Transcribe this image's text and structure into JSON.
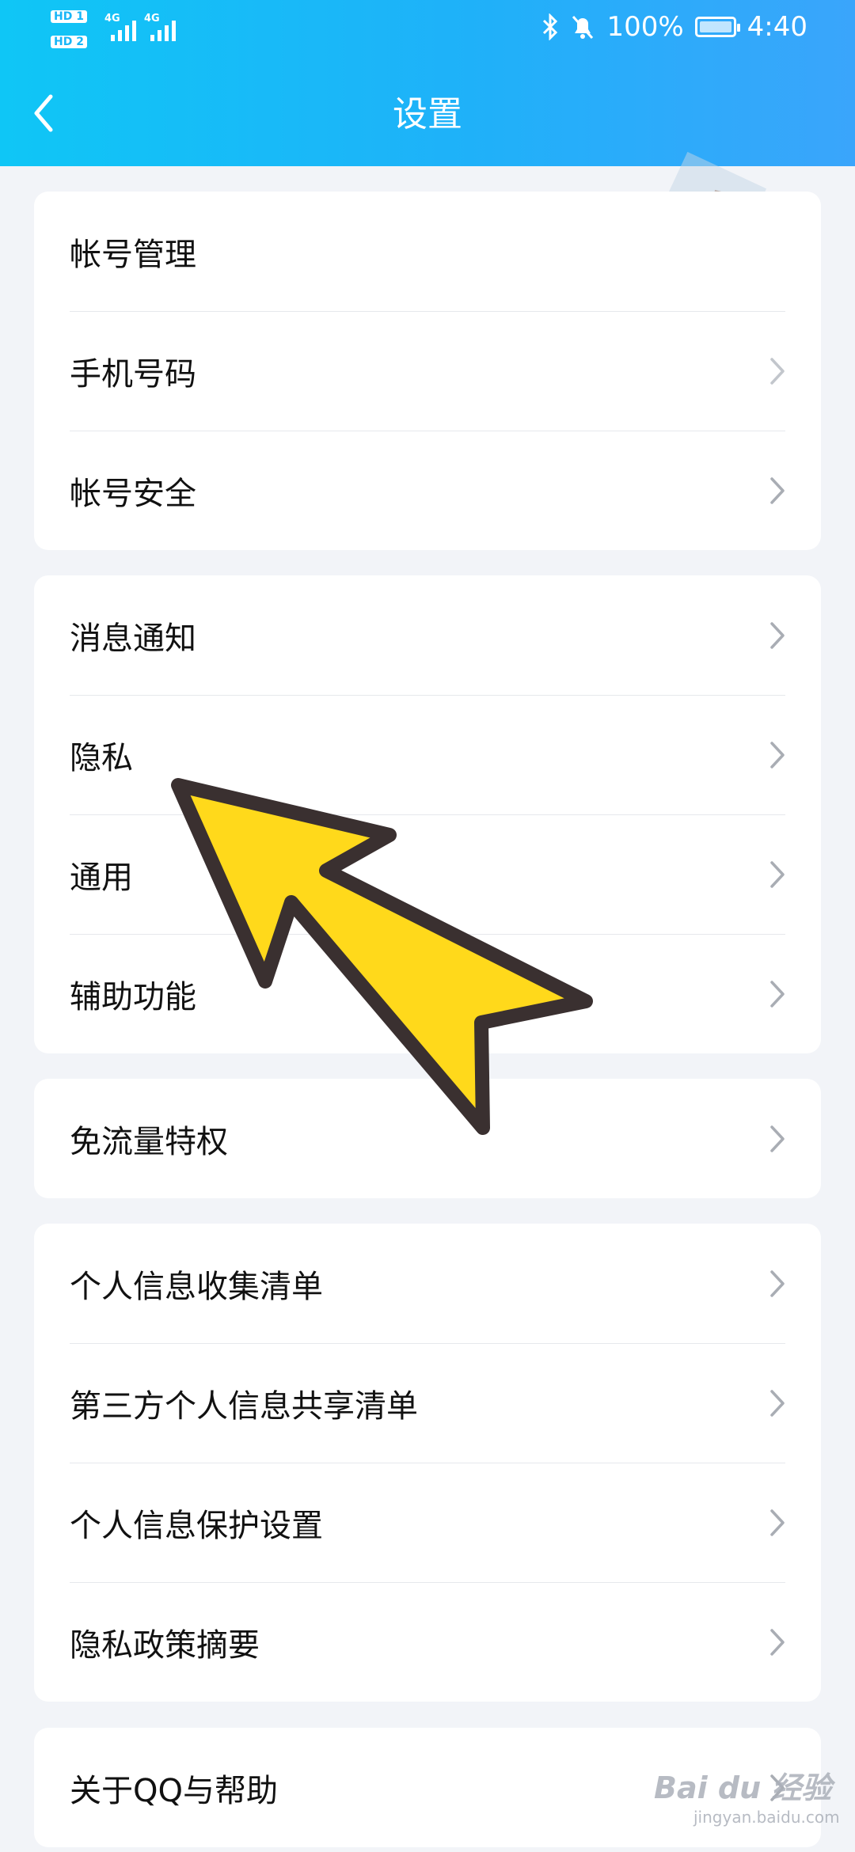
{
  "status": {
    "sim1": "HD 1",
    "sim2": "HD 2",
    "network1": "4G",
    "network2": "4G",
    "battery": "100%",
    "time": "4:40"
  },
  "header": {
    "title": "设置"
  },
  "groups": [
    {
      "items": [
        "帐号管理",
        "手机号码",
        "帐号安全"
      ]
    },
    {
      "items": [
        "消息通知",
        "隐私",
        "通用",
        "辅助功能"
      ]
    },
    {
      "items": [
        "免流量特权"
      ]
    },
    {
      "items": [
        "个人信息收集清单",
        "第三方个人信息共享清单",
        "个人信息保护设置",
        "隐私政策摘要"
      ]
    },
    {
      "items": [
        "关于QQ与帮助"
      ]
    }
  ],
  "watermark": {
    "brand": "Bai du 经验",
    "sub": "jingyan.baidu.com"
  },
  "colors": {
    "header": "#17b6f7",
    "background": "#f2f4f8",
    "arrow_fill": "#ffd91b",
    "arrow_stroke": "#3a3030"
  }
}
